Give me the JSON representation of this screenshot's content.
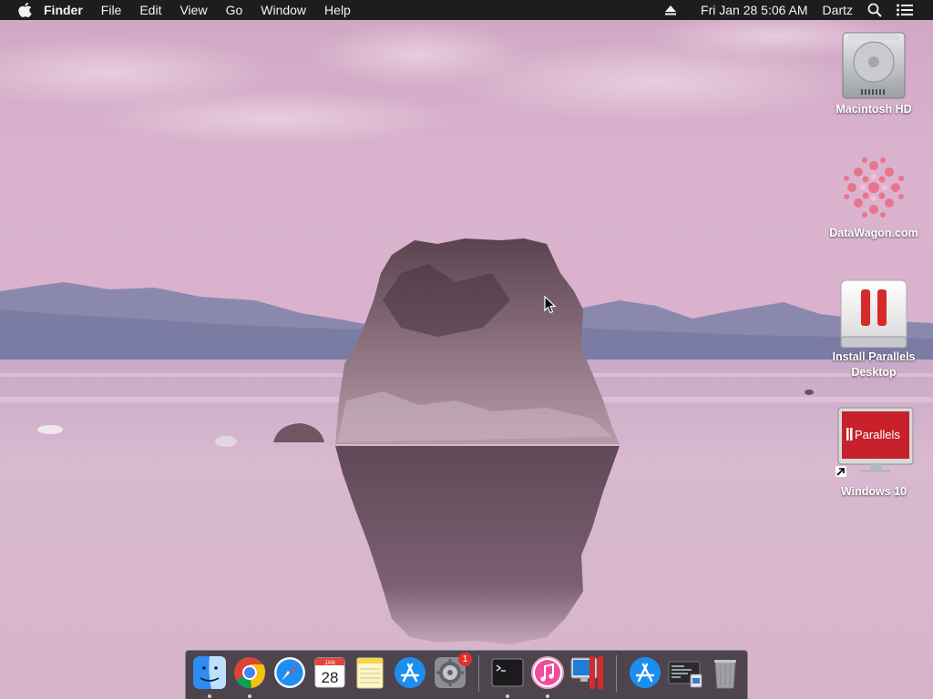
{
  "menubar": {
    "app_name": "Finder",
    "menus": [
      "File",
      "Edit",
      "View",
      "Go",
      "Window",
      "Help"
    ],
    "datetime": "Fri Jan 28  5:06 AM",
    "user": "Dartz"
  },
  "desktop_icons": [
    {
      "label": "Macintosh HD"
    },
    {
      "label": "DataWagon.com"
    },
    {
      "label": "Install Parallels Desktop"
    },
    {
      "label": "Windows 10",
      "sublabel": "Parallels"
    }
  ],
  "dock": {
    "items": [
      {
        "name": "Finder",
        "running": true
      },
      {
        "name": "Google Chrome",
        "running": true
      },
      {
        "name": "Safari",
        "running": false
      },
      {
        "name": "Calendar",
        "month": "JAN",
        "day": "28",
        "running": false
      },
      {
        "name": "Notes",
        "running": false
      },
      {
        "name": "App Store",
        "running": false
      },
      {
        "name": "System Preferences",
        "badge": "1",
        "running": false
      },
      {
        "name": "Terminal",
        "running": true
      },
      {
        "name": "iTunes",
        "running": true
      },
      {
        "name": "Parallels Desktop",
        "running": false
      },
      {
        "name": "App Store Downloads",
        "running": false
      },
      {
        "name": "Recent Documents",
        "running": false
      },
      {
        "name": "Trash",
        "running": false
      }
    ]
  },
  "colors": {
    "menubar_bg": "#1f1c20",
    "sky": "#c9a4bd",
    "water": "#d6b5c8",
    "parallels_red": "#d52b2b"
  }
}
